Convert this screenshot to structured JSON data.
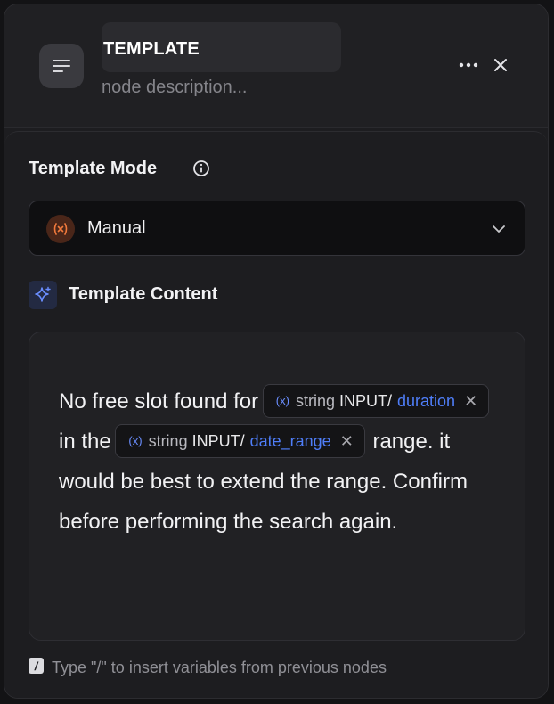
{
  "header": {
    "title": "TEMPLATE",
    "description_placeholder": "node description...",
    "node_icon": "align-left-icon",
    "more_icon": "more-horizontal-icon",
    "close_icon": "close-icon"
  },
  "template_mode": {
    "label": "Template Mode",
    "info_icon": "info-icon",
    "selected": "Manual",
    "selected_icon": "variable-icon",
    "accent_color": "#f27a3c"
  },
  "template_content": {
    "label": "Template Content",
    "icon": "sparkle-icon",
    "text_before": "No free slot found for",
    "chip1": {
      "type": "string",
      "scope": "INPUT/",
      "name": "duration"
    },
    "text_middle": "in the",
    "chip2": {
      "type": "string",
      "scope": "INPUT/",
      "name": "date_range"
    },
    "text_after": "range. it would be best to extend the range. Confirm before performing the search again."
  },
  "hint": {
    "key": "/",
    "text": "Type \"/\" to insert variables from previous nodes"
  },
  "colors": {
    "variable_blue": "#4f7ef8",
    "background": "#1d1d20"
  }
}
